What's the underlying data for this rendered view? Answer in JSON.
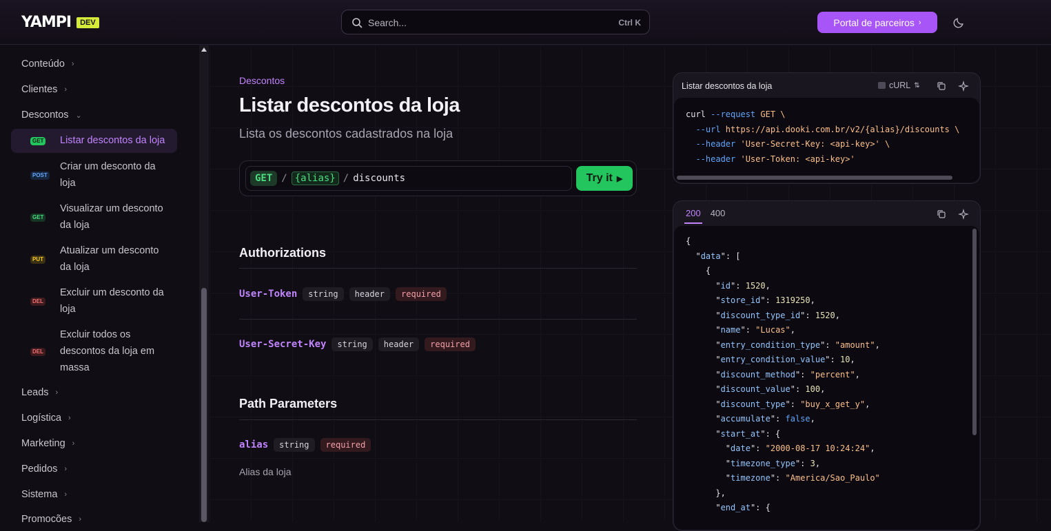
{
  "header": {
    "logo": "YAMPI",
    "badge": "DEV",
    "search_placeholder": "Search...",
    "search_shortcut": "Ctrl K",
    "partner_button": "Portal de parceiros"
  },
  "sidebar": {
    "groups_top": [
      {
        "label": "Conteúdo"
      },
      {
        "label": "Clientes"
      },
      {
        "label": "Descontos"
      }
    ],
    "items": [
      {
        "method": "GET",
        "label": "Listar descontos da loja",
        "active": true
      },
      {
        "method": "POST",
        "label": "Criar um desconto da loja"
      },
      {
        "method": "GET",
        "label": "Visualizar um desconto da loja"
      },
      {
        "method": "PUT",
        "label": "Atualizar um desconto da loja"
      },
      {
        "method": "DEL",
        "label": "Excluir um desconto da loja"
      },
      {
        "method": "DEL",
        "label": "Excluir todos os descontos da loja em massa"
      }
    ],
    "groups_bottom": [
      {
        "label": "Leads"
      },
      {
        "label": "Logística"
      },
      {
        "label": "Marketing"
      },
      {
        "label": "Pedidos"
      },
      {
        "label": "Sistema"
      },
      {
        "label": "Promoções"
      }
    ]
  },
  "main": {
    "breadcrumb": "Descontos",
    "title": "Listar descontos da loja",
    "subtitle": "Lista os descontos cadastrados na loja",
    "endpoint": {
      "method": "GET",
      "slash": "/",
      "param": "{alias}",
      "path": "discounts",
      "try_label": "Try it"
    },
    "authorizations_title": "Authorizations",
    "auth_params": [
      {
        "name": "User-Token",
        "type": "string",
        "location": "header",
        "required": "required"
      },
      {
        "name": "User-Secret-Key",
        "type": "string",
        "location": "header",
        "required": "required"
      }
    ],
    "path_title": "Path Parameters",
    "path_param": {
      "name": "alias",
      "type": "string",
      "required": "required",
      "description": "Alias da loja"
    }
  },
  "request_panel": {
    "title": "Listar descontos da loja",
    "language": "cURL",
    "lines": [
      [
        "curl ",
        "--request",
        " GET \\"
      ],
      [
        "  ",
        "--url",
        " https://api.dooki.com.br/v2/{alias}/discounts \\"
      ],
      [
        "  ",
        "--header",
        " 'User-Secret-Key: <api-key>' \\"
      ],
      [
        "  ",
        "--header",
        " 'User-Token: <api-key>'"
      ]
    ]
  },
  "response_panel": {
    "tabs": [
      "200",
      "400"
    ],
    "active_tab": "200",
    "json_lines": [
      "{",
      "  \"data\": [",
      "    {",
      "      \"id\": 1520,",
      "      \"store_id\": 1319250,",
      "      \"discount_type_id\": 1520,",
      "      \"name\": \"Lucas\",",
      "      \"entry_condition_type\": \"amount\",",
      "      \"entry_condition_value\": 10,",
      "      \"discount_method\": \"percent\",",
      "      \"discount_value\": 100,",
      "      \"discount_type\": \"buy_x_get_y\",",
      "      \"accumulate\": false,",
      "      \"start_at\": {",
      "        \"date\": \"2000-08-17 10:24:24\",",
      "        \"timezone_type\": 3,",
      "        \"timezone\": \"America/Sao_Paulo\"",
      "      },",
      "      \"end_at\": {"
    ]
  }
}
